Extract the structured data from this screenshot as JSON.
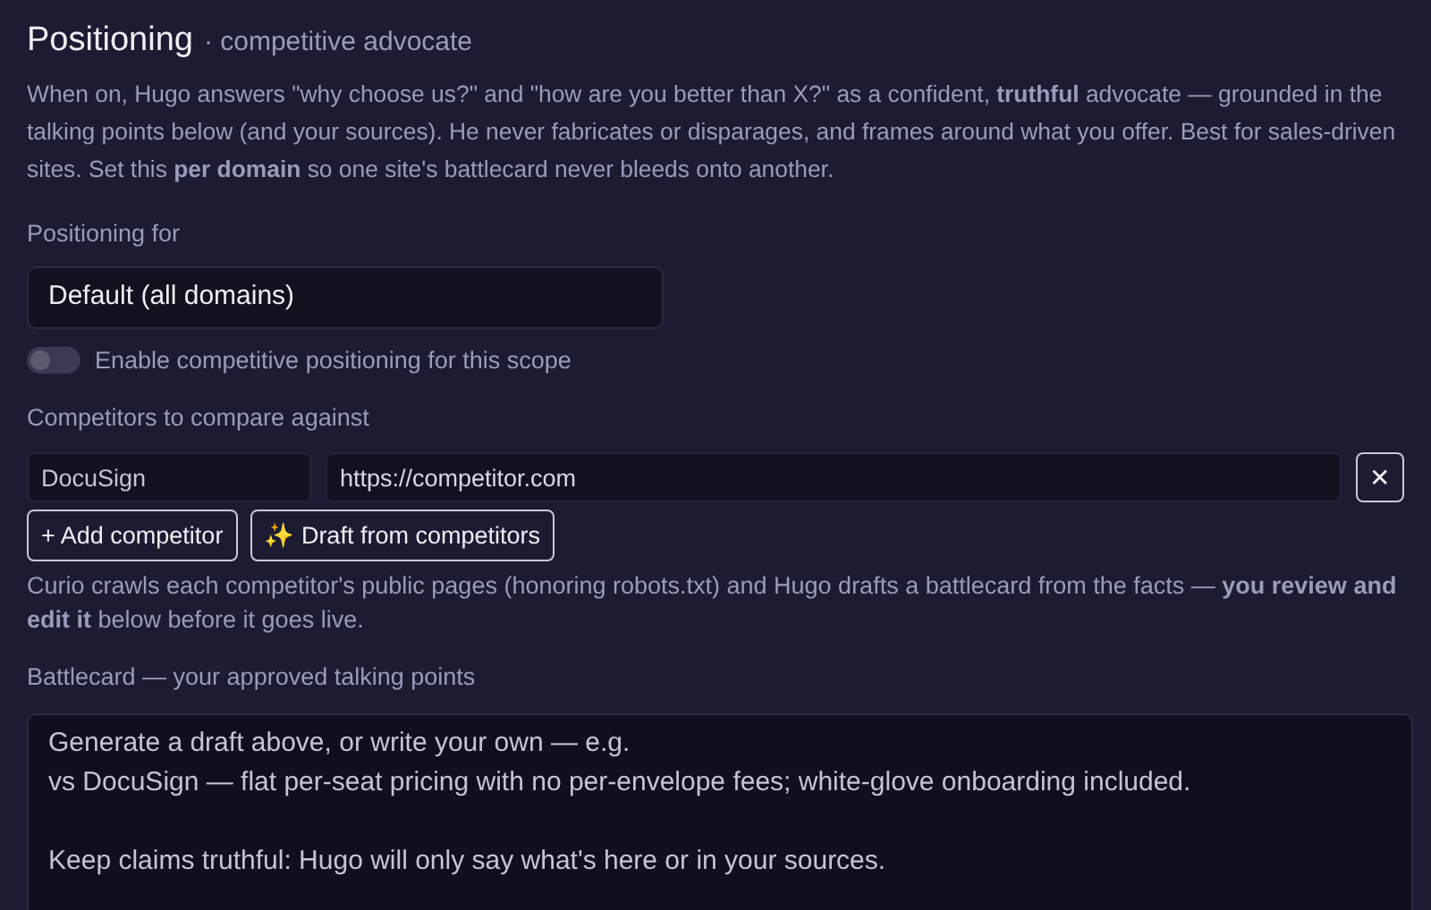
{
  "header": {
    "title": "Positioning",
    "subtitle": "· competitive advocate"
  },
  "description": "When on, Hugo answers \"why choose us?\" and \"how are you better than X?\" as a confident, **truthful** advocate — grounded in the talking points below (and your sources). He never fabricates or disparages, and frames around what you offer. Best for sales-driven sites. Set this **per domain** so one site's battlecard never bleeds onto another.",
  "scope": {
    "label": "Positioning for",
    "value": "Default (all domains)"
  },
  "toggle": {
    "label": "Enable competitive positioning for this scope",
    "on": false
  },
  "competitors": {
    "label": "Competitors to compare against",
    "rows": [
      {
        "name": "DocuSign",
        "url": "https://competitor.com",
        "remove": "✕"
      }
    ],
    "buttons": [
      "+ Add competitor",
      "✨ Draft from competitors"
    ],
    "note": "Curio crawls each competitor's public pages (honoring robots.txt) and Hugo drafts a battlecard from the facts — **you review and edit it** below before it goes live."
  },
  "battlecard": {
    "label": "Battlecard — your approved talking points",
    "placeholder": "Generate a draft above, or write your own — e.g.\nvs DocuSign — flat per-seat pricing with no per-envelope fees; white-glove onboarding included.\n\nKeep claims truthful: Hugo will only say what's here or in your sources."
  }
}
